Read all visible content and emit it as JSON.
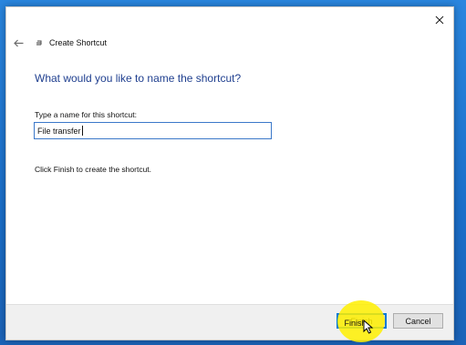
{
  "window": {
    "title": "Create Shortcut",
    "close_icon": "close-icon",
    "back_icon": "back-arrow-icon",
    "shortcut_icon": "shortcut-icon"
  },
  "main": {
    "heading": "What would you like to name the shortcut?",
    "field_label": "Type a name for this shortcut:",
    "field_value": "File transfer",
    "info": "Click Finish to create the shortcut."
  },
  "footer": {
    "finish_label": "Finish",
    "cancel_label": "Cancel"
  },
  "colors": {
    "heading": "#1f3f8f",
    "accent": "#0078d7",
    "desktop": "#1c7ad6",
    "highlight": "#fff000"
  }
}
